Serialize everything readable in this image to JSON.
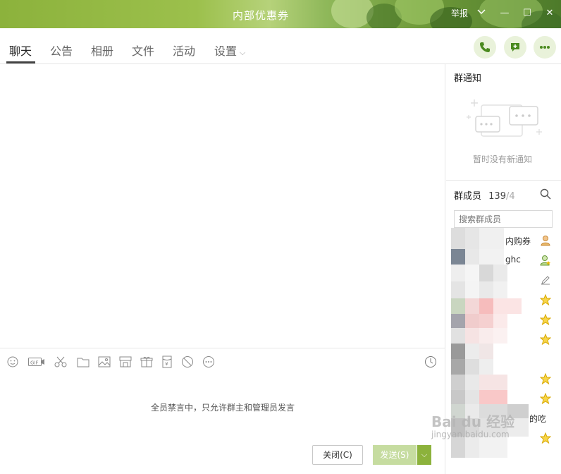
{
  "window": {
    "title": "内部优惠券",
    "report_label": "举报",
    "minimize": "—",
    "maximize": "☐",
    "close": "✕"
  },
  "tabs": [
    {
      "label": "聊天",
      "active": true
    },
    {
      "label": "公告"
    },
    {
      "label": "相册"
    },
    {
      "label": "文件"
    },
    {
      "label": "活动"
    },
    {
      "label": "设置",
      "caret": "⌵"
    }
  ],
  "toolbar_icons": [
    "emoji-icon",
    "gif-icon",
    "scissors-icon",
    "folder-icon",
    "image-icon",
    "shop-icon",
    "gift-icon",
    "red-packet-icon",
    "forbid-icon",
    "more-icon"
  ],
  "input": {
    "mute_note": "全员禁言中，只允许群主和管理员发言",
    "close_label": "关闭(C)",
    "send_label": "发送(S)",
    "send_dropdown": "⌵"
  },
  "right_panel": {
    "notice_title": "群通知",
    "notice_empty": "暂时没有新通知",
    "members_title": "群成员",
    "member_count": "139",
    "member_total": "/4",
    "search_placeholder": "搜索群成员",
    "members": [
      {
        "name": "内购券",
        "badge": "owner-icon"
      },
      {
        "name": "ghc",
        "badge": "admin-icon"
      },
      {
        "name": "",
        "badge": "edit-icon"
      },
      {
        "name": "",
        "badge": "star-icon"
      },
      {
        "name": "",
        "badge": "star-icon"
      },
      {
        "name": "",
        "badge": "star-icon"
      },
      {
        "name": "",
        "badge": ""
      },
      {
        "name": "",
        "badge": "star-icon"
      },
      {
        "name": "",
        "badge": "star-icon"
      },
      {
        "name": "的吃",
        "badge": ""
      },
      {
        "name": "",
        "badge": "star-icon"
      }
    ]
  },
  "watermark": {
    "brand": "Bai du 经验",
    "url": "jingyan.baidu.com"
  },
  "colors": {
    "accent": "#8cb23c",
    "tab_active_underline": "#444444",
    "icon_green": "#4a8a1e",
    "star": "#e8b800"
  }
}
